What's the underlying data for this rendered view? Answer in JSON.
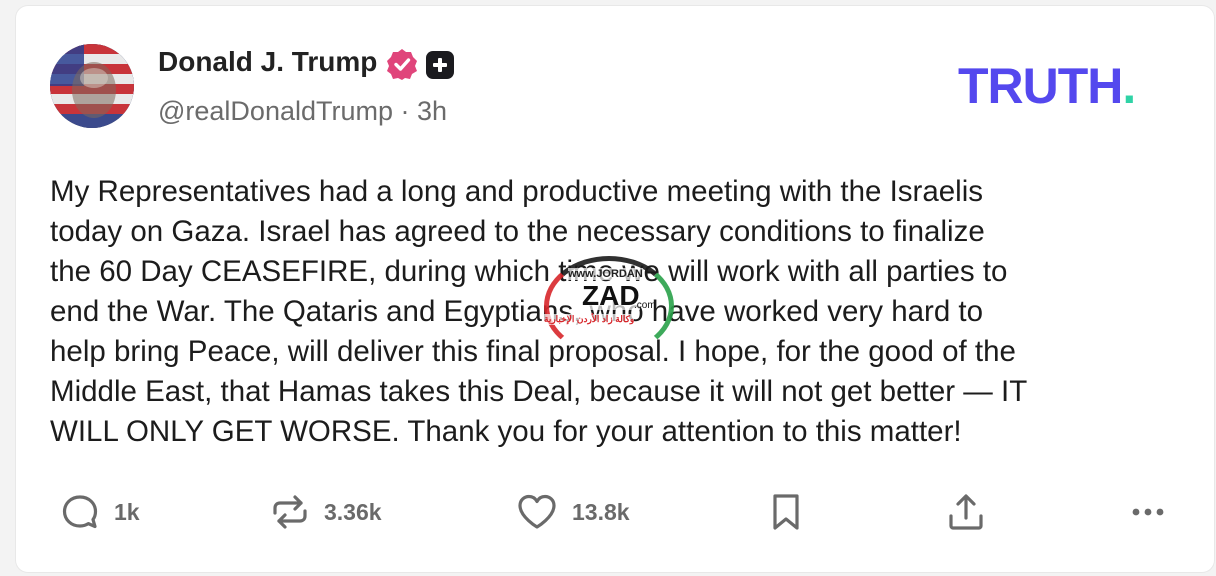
{
  "author": {
    "display_name": "Donald J. Trump",
    "verified_icon": "verified-check-icon",
    "plus_icon": "plus-badge-icon",
    "handle": "@realDonaldTrump",
    "separator": "·",
    "time_ago": "3h"
  },
  "brand": {
    "logo_text": "TRUTH",
    "logo_dot": ".",
    "color": "#5448ee",
    "dot_color": "#2fd3a6"
  },
  "post": {
    "lines": [
      "My Representatives had a long and productive meeting with the Israelis",
      "today on Gaza. Israel has agreed to the necessary conditions to finalize",
      "the 60 Day CEASEFIRE, during which time we will work with all parties to",
      "end the War. The Qataris and Egyptians, who have worked very hard to",
      "help bring Peace, will deliver this final proposal. I hope, for the good of the",
      "Middle East, that Hamas takes this Deal, because it will not get better — IT",
      "WILL ONLY GET WORSE. Thank you for your attention to this matter!"
    ]
  },
  "watermark": {
    "small": "www.JORDAN",
    "big": "ZAD",
    "suffix": ".com",
    "tagline": "وكالة زاد الأردن الإخبارية"
  },
  "actions": {
    "reply": {
      "icon": "reply-icon",
      "count": "1k"
    },
    "retruth": {
      "icon": "retruth-icon",
      "count": "3.36k"
    },
    "like": {
      "icon": "heart-icon",
      "count": "13.8k"
    },
    "bookmark": {
      "icon": "bookmark-icon"
    },
    "share": {
      "icon": "share-icon"
    },
    "more": {
      "icon": "more-icon"
    }
  },
  "colors": {
    "verified": "#e0457b",
    "text": "#1c1c1c",
    "muted": "#6b6b6b",
    "icon": "#6a6a6a"
  }
}
